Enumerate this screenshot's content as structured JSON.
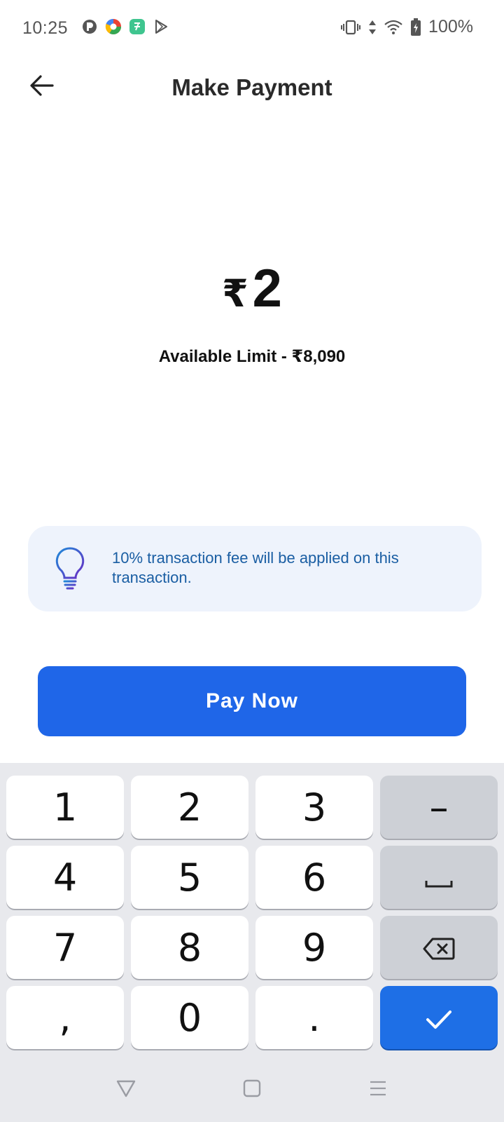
{
  "status_bar": {
    "time": "10:25",
    "battery": "100%",
    "app_icons": [
      "pulse-icon",
      "chrome-like-icon",
      "money-app-icon",
      "play-store-icon"
    ],
    "system_icons": [
      "vibrate-icon",
      "data-arrows-icon",
      "wifi-icon",
      "battery-charging-icon"
    ]
  },
  "header": {
    "title": "Make Payment",
    "back_icon": "arrow-left-icon"
  },
  "payment": {
    "currency_symbol": "₹",
    "amount": "2",
    "available_limit": "Available Limit - ₹8,090"
  },
  "info": {
    "icon": "lightbulb-icon",
    "text": "10% transaction fee will be applied on this transaction."
  },
  "pay_button": {
    "label": "Pay Now"
  },
  "keyboard": {
    "keys": [
      "1",
      "2",
      "3",
      "–",
      "4",
      "5",
      "6",
      "␣",
      "7",
      "8",
      "9",
      "⌫",
      ",",
      "0",
      ".",
      "✓"
    ]
  },
  "nav_bar": {
    "icons": [
      "back-triangle-icon",
      "home-square-icon",
      "menu-lines-icon"
    ]
  },
  "colors": {
    "accent": "#1f66e8",
    "info_bg": "#eef3fc",
    "info_text": "#1a5ea3",
    "keyboard_bg": "#e8e9ed"
  }
}
